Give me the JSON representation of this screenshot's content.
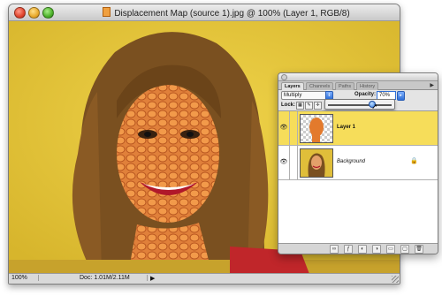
{
  "window": {
    "title": "Displacement Map (source 1).jpg @ 100% (Layer 1, RGB/8)",
    "close_icon": "close-icon",
    "minimize_icon": "minimize-icon",
    "maximize_icon": "zoom-icon"
  },
  "status": {
    "zoom": "100%",
    "doc": "Doc: 1.01M/2.11M",
    "arrow": "▶"
  },
  "palette": {
    "tabs": [
      {
        "label": "Layers",
        "active": true
      },
      {
        "label": "Channels",
        "active": false
      },
      {
        "label": "Paths",
        "active": false
      },
      {
        "label": "History",
        "active": false
      }
    ],
    "menu_glyph": "▶",
    "blend_mode": "Multiply",
    "opacity_label": "Opacity:",
    "opacity_value": "70%",
    "opacity_slider_fraction": 0.7,
    "lock_label": "Lock:",
    "layers": [
      {
        "name": "Layer 1",
        "selected": true,
        "visible_glyph": "👁"
      },
      {
        "name": "Background",
        "selected": false,
        "visible_glyph": "👁",
        "lock_glyph": "🔒"
      }
    ],
    "bottom_buttons": [
      "∞",
      "ƒ",
      "◐",
      "◑",
      "▭",
      "▢",
      "🗑"
    ]
  },
  "colors": {
    "canvas_bg": "#e7c93d",
    "selected_layer": "#f6dd5a",
    "accent_blue": "#2f6fd6"
  }
}
